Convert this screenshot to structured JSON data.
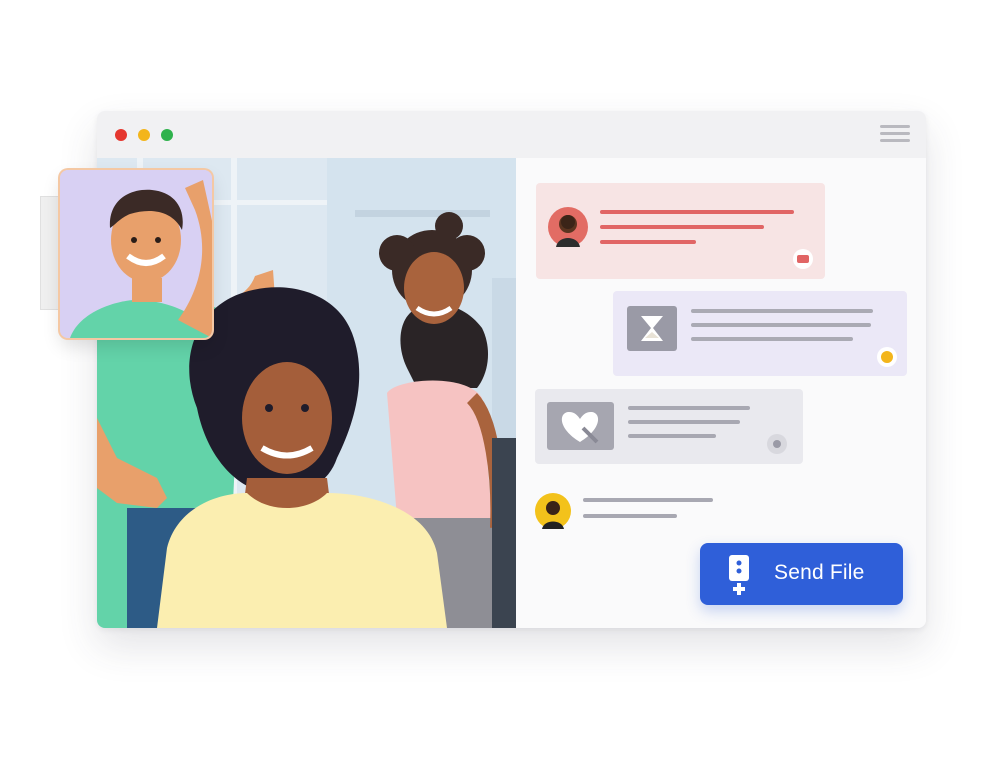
{
  "window": {
    "traffic_lights": [
      "#e5372f",
      "#f3b51b",
      "#2fb24c"
    ],
    "menu_icon": "hamburger-menu-icon"
  },
  "chat": {
    "messages": [
      {
        "type": "incoming-text",
        "bg": "#f7e4e4",
        "accent": "#e16565",
        "avatar": "avatar-man-beard"
      },
      {
        "type": "outgoing-image",
        "bg": "#ebe8f7",
        "icon": "hourglass-image-icon"
      },
      {
        "type": "incoming-image",
        "bg": "#e9e9ee",
        "icon": "heart-image-icon"
      },
      {
        "type": "incoming-text",
        "bg": "none",
        "avatar": "avatar-person-yellow"
      }
    ]
  },
  "send_button": {
    "label": "Send File",
    "icon": "file-upload-icon",
    "color": "#2f5fd9"
  }
}
